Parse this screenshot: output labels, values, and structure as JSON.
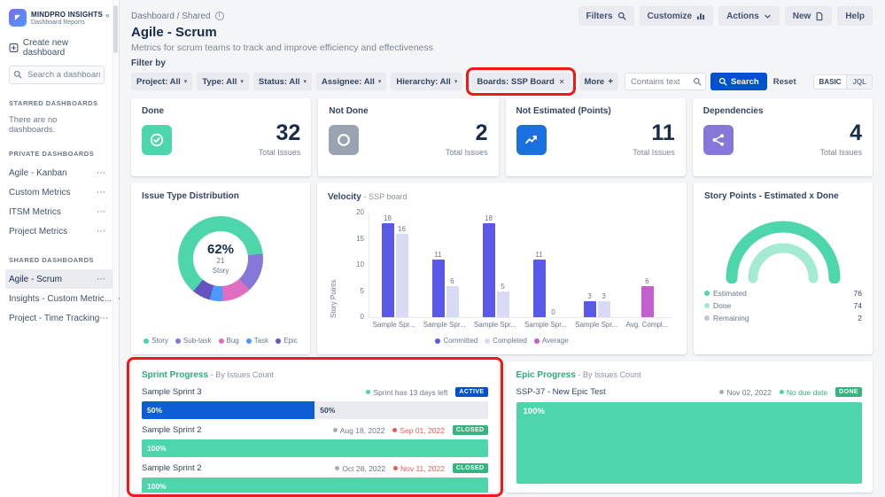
{
  "colors": {
    "accent_blue": "#0052cc",
    "mint_green": "#4cd6a9",
    "badge_green": "#36b37e",
    "danger_red": "#eb5a5a",
    "annotation_red": "#f21818"
  },
  "sidebar": {
    "brand_title": "MINDPRO INSIGHTS",
    "brand_subtitle": "Dashboard Reports",
    "create_label": "Create new dashboard",
    "search_placeholder": "Search a dashboard...",
    "starred_header": "STARRED DASHBOARDS",
    "starred_empty": "There are no dashboards.",
    "private_header": "PRIVATE DASHBOARDS",
    "private_items": [
      "Agile - Kanban",
      "Custom Metrics",
      "ITSM Metrics",
      "Project Metrics"
    ],
    "shared_header": "SHARED DASHBOARDS",
    "shared_items": [
      "Agile - Scrum",
      "Insights - Custom Metric...",
      "Project - Time Tracking"
    ],
    "selected_item": "Agile - Scrum"
  },
  "topbar": {
    "breadcrumb": "Dashboard / Shared",
    "actions": [
      {
        "label": "Filters",
        "icon": "search"
      },
      {
        "label": "Customize",
        "icon": "chart"
      },
      {
        "label": "Actions",
        "icon": "chevron"
      },
      {
        "label": "New",
        "icon": "page"
      },
      {
        "label": "Help",
        "icon": ""
      }
    ]
  },
  "page": {
    "title": "Agile - Scrum",
    "subtitle": "Metrics for scrum teams to track and improve efficiency and effectiveness"
  },
  "filters": {
    "label": "Filter by",
    "chips": [
      "Project: All",
      "Type: All",
      "Status: All",
      "Assignee: All",
      "Hierarchy: All"
    ],
    "boards_chip": "Boards: SSP Board",
    "more_chip": "More",
    "contains_placeholder": "Contains text",
    "search_label": "Search",
    "reset_label": "Reset",
    "mode_basic": "BASIC",
    "mode_jql": "JQL"
  },
  "stats": [
    {
      "title": "Done",
      "value": "32",
      "caption": "Total Issues",
      "icon": "check-circle",
      "icon_bg": "#4cd6a9"
    },
    {
      "title": "Not Done",
      "value": "2",
      "caption": "Total Issues",
      "icon": "circle",
      "icon_bg": "#99a3b2"
    },
    {
      "title": "Not Estimated (Points)",
      "value": "11",
      "caption": "Total Issues",
      "icon": "trend",
      "icon_bg": "#1b6fde"
    },
    {
      "title": "Dependencies",
      "value": "4",
      "caption": "Total Issues",
      "icon": "dependency",
      "icon_bg": "#8777d9"
    }
  ],
  "chart_data": [
    {
      "type": "pie",
      "title": "Issue Type Distribution",
      "center_percent": "62%",
      "center_count": "21",
      "center_label": "Story",
      "segments": [
        {
          "label": "Story",
          "percent": 62,
          "color": "#4cd6a9"
        },
        {
          "label": "Sub-task",
          "percent": 15,
          "color": "#8777d9"
        },
        {
          "label": "Bug",
          "percent": 11,
          "color": "#e06ec0"
        },
        {
          "label": "Task",
          "percent": 5,
          "color": "#4c9aff"
        },
        {
          "label": "Epic",
          "percent": 7,
          "color": "#6554c0"
        }
      ]
    },
    {
      "type": "bar",
      "title": "Velocity",
      "subtitle": "- SSP board",
      "ylabel": "Story Points",
      "ylim": [
        0,
        20
      ],
      "yticks": [
        0,
        5,
        10,
        15,
        20
      ],
      "categories": [
        "Sample Spr...",
        "Sample Spr...",
        "Sample Spr...",
        "Sample Spr...",
        "Sample Spr...",
        "Avg. Compl..."
      ],
      "series": [
        {
          "name": "Committed",
          "color": "#5a58e6",
          "values": [
            18,
            11,
            18,
            11,
            3,
            null
          ]
        },
        {
          "name": "Completed",
          "color": "#d9daf6",
          "values": [
            16,
            6,
            5,
            0,
            3,
            null
          ]
        },
        {
          "name": "Average",
          "color": "#c45fd0",
          "values": [
            null,
            null,
            null,
            null,
            null,
            6
          ]
        }
      ]
    },
    {
      "type": "gauge",
      "title": "Story Points - Estimated x Done",
      "legend": [
        {
          "label": "Estimated",
          "value": "76",
          "color": "#4cd6a9"
        },
        {
          "label": "Done",
          "value": "74",
          "color": "#a5ebd3"
        },
        {
          "label": "Remaining",
          "value": "2",
          "color": "#c1c7d0"
        }
      ]
    }
  ],
  "sprint_progress": {
    "title": "Sprint Progress",
    "subtitle": "- By Issues Count",
    "rows": [
      {
        "name": "Sample Sprint 3",
        "meta": [
          {
            "text": "Sprint has 13 days left",
            "dot": "#4cd6a9",
            "color": "#6b778c"
          }
        ],
        "badge": {
          "label": "ACTIVE",
          "color": "#0052cc"
        },
        "segments": [
          {
            "pct": 50,
            "color": "#0c5dd6",
            "label": "50%",
            "label_color": "#ffffff"
          },
          {
            "pct": 50,
            "color": "#e9ebf0",
            "label": "50%",
            "label_color": "#344563"
          }
        ]
      },
      {
        "name": "Sample Sprint 2",
        "meta": [
          {
            "text": "Aug 18, 2022",
            "dot": "#a5adba",
            "color": "#6b778c"
          },
          {
            "text": "Sep 01, 2022",
            "dot": "#eb5a5a",
            "color": "#eb5a5a"
          }
        ],
        "badge": {
          "label": "CLOSED",
          "color": "#36b37e"
        },
        "segments": [
          {
            "pct": 100,
            "color": "#4cd6a9",
            "label": "100%",
            "label_color": "#ffffff"
          }
        ]
      },
      {
        "name": "Sample Sprint 2",
        "meta": [
          {
            "text": "Oct 28, 2022",
            "dot": "#a5adba",
            "color": "#6b778c"
          },
          {
            "text": "Nov 11, 2022",
            "dot": "#eb5a5a",
            "color": "#eb5a5a"
          }
        ],
        "badge": {
          "label": "CLOSED",
          "color": "#36b37e"
        },
        "segments": [
          {
            "pct": 100,
            "color": "#4cd6a9",
            "label": "100%",
            "label_color": "#ffffff"
          }
        ]
      }
    ]
  },
  "epic_progress": {
    "title": "Epic Progress",
    "subtitle": "- By Issues Count",
    "row": {
      "name": "SSP-37 - New Epic Test",
      "meta": [
        {
          "text": "Nov 02, 2022",
          "dot": "#a5adba",
          "color": "#6b778c"
        },
        {
          "text": "No due date",
          "dot": "#4cd6a9",
          "color": "#36b37e"
        }
      ],
      "badge": {
        "label": "DONE",
        "color": "#36b37e"
      }
    },
    "bar_label": "100%",
    "bar_color": "#4cd6a9"
  }
}
